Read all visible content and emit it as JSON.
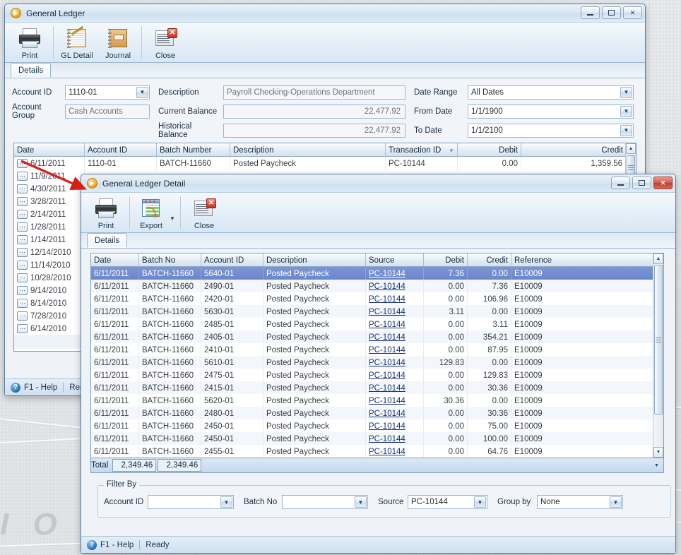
{
  "desktop": {
    "watermark": "I O N"
  },
  "main_window": {
    "title": "General Ledger",
    "app_icon": "play-orb-icon",
    "window_buttons": {
      "minimize": "minimize-icon",
      "maximize": "maximize-icon",
      "close": "close-icon"
    },
    "toolbar": [
      {
        "label": "Print",
        "icon": "printer-icon"
      },
      {
        "label": "GL Detail",
        "icon": "ledger-icon"
      },
      {
        "label": "Journal",
        "icon": "journal-icon"
      },
      {
        "label": "Close",
        "icon": "close-document-icon"
      }
    ],
    "tabs": [
      {
        "label": "Details",
        "active": true
      }
    ],
    "form": {
      "account_id_label": "Account ID",
      "account_id_value": "1110-01",
      "account_group_label": "Account Group",
      "account_group_value": "Cash Accounts",
      "description_label": "Description",
      "description_value": "Payroll Checking-Operations Department",
      "current_balance_label": "Current Balance",
      "current_balance_value": "22,477.92",
      "historical_balance_label": "Historical Balance",
      "historical_balance_value": "22,477.92",
      "date_range_label": "Date Range",
      "date_range_value": "All Dates",
      "from_date_label": "From Date",
      "from_date_value": "1/1/1900",
      "to_date_label": "To Date",
      "to_date_value": "1/1/2100"
    },
    "grid": {
      "columns": [
        "Date",
        "Account ID",
        "Batch Number",
        "Description",
        "Transaction ID",
        "Debit",
        "Credit"
      ],
      "sorted_column": "Transaction ID",
      "sort_direction": "descending",
      "first_row": {
        "date": "6/11/2011",
        "account_id": "1110-01",
        "batch_number": "BATCH-11660",
        "description": "Posted  Paycheck",
        "transaction_id": "PC-10144",
        "debit": "0.00",
        "credit": "1,359.56"
      },
      "date_column_values": [
        "6/11/2011",
        "11/9/2011",
        "4/30/2011",
        "3/28/2011",
        "2/14/2011",
        "1/28/2011",
        "1/14/2011",
        "12/14/2010",
        "11/14/2010",
        "10/28/2010",
        "9/14/2010",
        "8/14/2010",
        "7/28/2010",
        "6/14/2010"
      ]
    },
    "statusbar": {
      "help": "F1 - Help",
      "status": "Rea"
    }
  },
  "detail_window": {
    "title": "General Ledger Detail",
    "app_icon": "play-orb-icon",
    "window_buttons": {
      "minimize": "minimize-icon",
      "maximize": "maximize-icon",
      "close": "close-icon"
    },
    "toolbar": [
      {
        "label": "Print",
        "icon": "printer-icon"
      },
      {
        "label": "Export",
        "icon": "export-grid-icon",
        "has_dropdown": true
      },
      {
        "label": "Close",
        "icon": "close-document-icon"
      }
    ],
    "tabs": [
      {
        "label": "Details",
        "active": true
      }
    ],
    "grid": {
      "columns": [
        "Date",
        "Batch No",
        "Account ID",
        "Description",
        "Source",
        "Debit",
        "Credit",
        "Reference"
      ],
      "rows": [
        {
          "date": "6/11/2011",
          "batch_no": "BATCH-11660",
          "account_id": "5640-01",
          "description": "Posted  Paycheck",
          "source": "PC-10144",
          "debit": "7.36",
          "credit": "0.00",
          "reference": "E10009",
          "selected": true
        },
        {
          "date": "6/11/2011",
          "batch_no": "BATCH-11660",
          "account_id": "2490-01",
          "description": "Posted  Paycheck",
          "source": "PC-10144",
          "debit": "0.00",
          "credit": "7.36",
          "reference": "E10009"
        },
        {
          "date": "6/11/2011",
          "batch_no": "BATCH-11660",
          "account_id": "2420-01",
          "description": "Posted  Paycheck",
          "source": "PC-10144",
          "debit": "0.00",
          "credit": "106.96",
          "reference": "E10009"
        },
        {
          "date": "6/11/2011",
          "batch_no": "BATCH-11660",
          "account_id": "5630-01",
          "description": "Posted  Paycheck",
          "source": "PC-10144",
          "debit": "3.11",
          "credit": "0.00",
          "reference": "E10009"
        },
        {
          "date": "6/11/2011",
          "batch_no": "BATCH-11660",
          "account_id": "2485-01",
          "description": "Posted  Paycheck",
          "source": "PC-10144",
          "debit": "0.00",
          "credit": "3.11",
          "reference": "E10009"
        },
        {
          "date": "6/11/2011",
          "batch_no": "BATCH-11660",
          "account_id": "2405-01",
          "description": "Posted  Paycheck",
          "source": "PC-10144",
          "debit": "0.00",
          "credit": "354.21",
          "reference": "E10009"
        },
        {
          "date": "6/11/2011",
          "batch_no": "BATCH-11660",
          "account_id": "2410-01",
          "description": "Posted  Paycheck",
          "source": "PC-10144",
          "debit": "0.00",
          "credit": "87.95",
          "reference": "E10009"
        },
        {
          "date": "6/11/2011",
          "batch_no": "BATCH-11660",
          "account_id": "5610-01",
          "description": "Posted  Paycheck",
          "source": "PC-10144",
          "debit": "129.83",
          "credit": "0.00",
          "reference": "E10009"
        },
        {
          "date": "6/11/2011",
          "batch_no": "BATCH-11660",
          "account_id": "2475-01",
          "description": "Posted  Paycheck",
          "source": "PC-10144",
          "debit": "0.00",
          "credit": "129.83",
          "reference": "E10009"
        },
        {
          "date": "6/11/2011",
          "batch_no": "BATCH-11660",
          "account_id": "2415-01",
          "description": "Posted  Paycheck",
          "source": "PC-10144",
          "debit": "0.00",
          "credit": "30.36",
          "reference": "E10009"
        },
        {
          "date": "6/11/2011",
          "batch_no": "BATCH-11660",
          "account_id": "5620-01",
          "description": "Posted  Paycheck",
          "source": "PC-10144",
          "debit": "30.36",
          "credit": "0.00",
          "reference": "E10009"
        },
        {
          "date": "6/11/2011",
          "batch_no": "BATCH-11660",
          "account_id": "2480-01",
          "description": "Posted  Paycheck",
          "source": "PC-10144",
          "debit": "0.00",
          "credit": "30.36",
          "reference": "E10009"
        },
        {
          "date": "6/11/2011",
          "batch_no": "BATCH-11660",
          "account_id": "2450-01",
          "description": "Posted  Paycheck",
          "source": "PC-10144",
          "debit": "0.00",
          "credit": "75.00",
          "reference": "E10009"
        },
        {
          "date": "6/11/2011",
          "batch_no": "BATCH-11660",
          "account_id": "2450-01",
          "description": "Posted  Paycheck",
          "source": "PC-10144",
          "debit": "0.00",
          "credit": "100.00",
          "reference": "E10009"
        },
        {
          "date": "6/11/2011",
          "batch_no": "BATCH-11660",
          "account_id": "2455-01",
          "description": "Posted  Paycheck",
          "source": "PC-10144",
          "debit": "0.00",
          "credit": "64.76",
          "reference": "E10009"
        }
      ],
      "total_label": "Total",
      "total_debit": "2,349.46",
      "total_credit": "2,349.46"
    },
    "filter": {
      "legend": "Filter By",
      "account_id_label": "Account ID",
      "account_id_value": "",
      "batch_no_label": "Batch No",
      "batch_no_value": "",
      "source_label": "Source",
      "source_value": "PC-10144",
      "group_by_label": "Group by",
      "group_by_value": "None"
    },
    "statusbar": {
      "help": "F1 - Help",
      "status": "Ready"
    }
  }
}
